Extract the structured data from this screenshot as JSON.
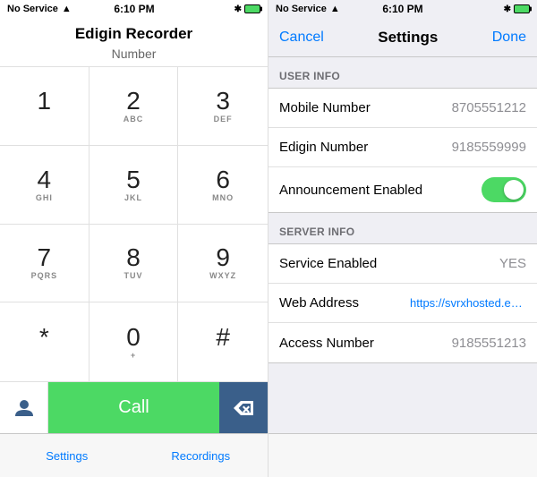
{
  "left": {
    "status": {
      "no_service": "No Service",
      "time": "6:10 PM"
    },
    "title": "Edigin Recorder",
    "number_label": "Number",
    "dialpad": [
      {
        "digit": "1",
        "letters": ""
      },
      {
        "digit": "2",
        "letters": "ABC"
      },
      {
        "digit": "3",
        "letters": "DEF"
      },
      {
        "digit": "4",
        "letters": "GHI"
      },
      {
        "digit": "5",
        "letters": "JKL"
      },
      {
        "digit": "6",
        "letters": "MNO"
      },
      {
        "digit": "7",
        "letters": "PQRS"
      },
      {
        "digit": "8",
        "letters": "TUV"
      },
      {
        "digit": "9",
        "letters": "WXYZ"
      },
      {
        "digit": "*",
        "letters": ""
      },
      {
        "digit": "0",
        "letters": "+"
      },
      {
        "digit": "#",
        "letters": ""
      }
    ],
    "call_label": "Call",
    "tabs": [
      {
        "label": "Settings"
      },
      {
        "label": "Recordings"
      }
    ]
  },
  "right": {
    "status": {
      "no_service": "No Service",
      "time": "6:10 PM"
    },
    "nav": {
      "cancel": "Cancel",
      "title": "Settings",
      "done": "Done"
    },
    "sections": [
      {
        "header": "USER INFO",
        "rows": [
          {
            "label": "Mobile Number",
            "value": "8705551212",
            "type": "text"
          },
          {
            "label": "Edigin Number",
            "value": "9185559999",
            "type": "text"
          },
          {
            "label": "Announcement Enabled",
            "value": "",
            "type": "toggle"
          }
        ]
      },
      {
        "header": "SERVER INFO",
        "rows": [
          {
            "label": "Service Enabled",
            "value": "YES",
            "type": "text"
          },
          {
            "label": "Web Address",
            "value": "https://svrxhosted.ed...",
            "type": "link"
          },
          {
            "label": "Access Number",
            "value": "9185551213",
            "type": "text"
          }
        ]
      }
    ]
  }
}
